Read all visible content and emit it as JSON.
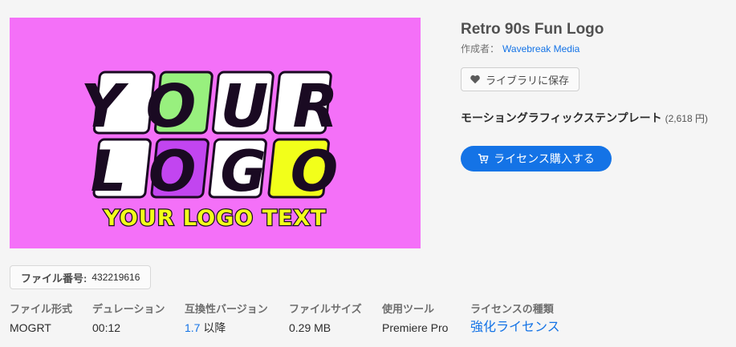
{
  "preview": {
    "logo_line1": "YOUR",
    "logo_line2": "LOGO",
    "logo_tagline": "YOUR LOGO TEXT",
    "colors": {
      "background": "#f470f8",
      "white": "#ffffff",
      "green": "#98f07e",
      "purple": "#c245f0",
      "yellow": "#f2ff1a",
      "outline": "#1a0a22"
    }
  },
  "title": "Retro 90s Fun Logo",
  "author": {
    "label": "作成者：",
    "name": "Wavebreak Media"
  },
  "save_button": {
    "label": "ライブラリに保存",
    "icon": "heart-icon"
  },
  "product": {
    "type": "モーショングラフィックステンプレート",
    "price": "(2,618 円)"
  },
  "buy_button": {
    "label": "ライセンス購入する",
    "icon": "cart-icon"
  },
  "file_id": {
    "label": "ファイル番号:",
    "value": "432219616"
  },
  "meta": [
    {
      "key": "ファイル形式",
      "value": "MOGRT"
    },
    {
      "key": "デュレーション",
      "value": "00:12"
    },
    {
      "key": "互換性バージョン",
      "value_num": "1.7",
      "value_suffix": " 以降"
    },
    {
      "key": "ファイルサイズ",
      "value": "0.29 MB"
    },
    {
      "key": "使用ツール",
      "value": "Premiere Pro"
    },
    {
      "key": "ライセンスの種類",
      "value": "強化ライセンス"
    }
  ],
  "accent_color": "#1473e6"
}
